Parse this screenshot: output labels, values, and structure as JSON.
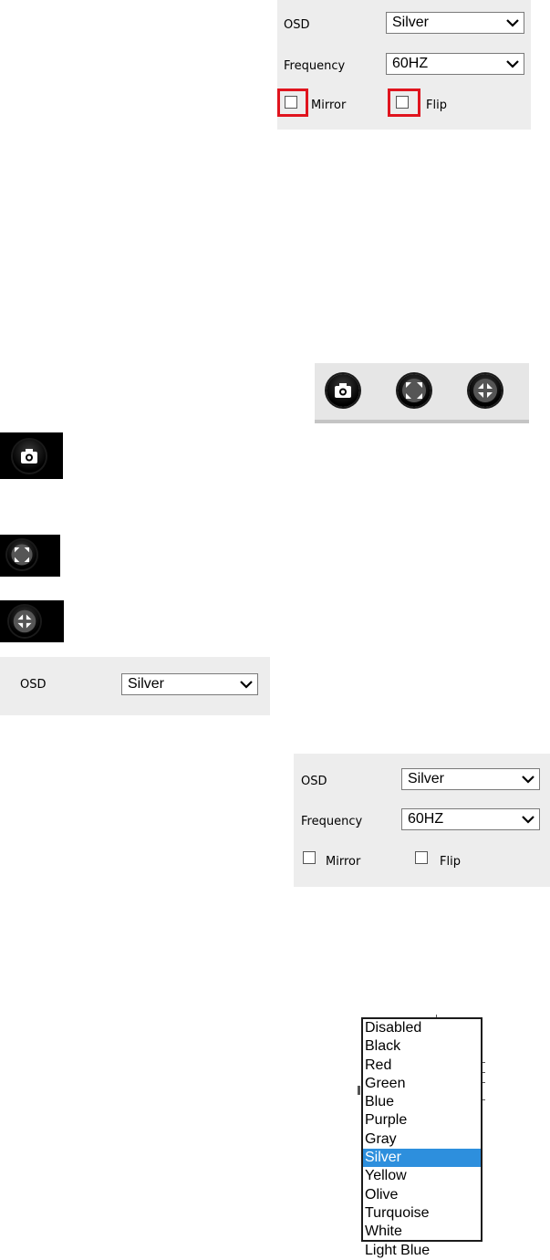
{
  "top_panel": {
    "osd_label": "OSD",
    "osd_value": "Silver",
    "frequency_label": "Frequency",
    "frequency_value": "60HZ",
    "mirror_label": "Mirror",
    "flip_label": "Flip",
    "highlight_color": "#e0141e"
  },
  "toolbar": {
    "icons": [
      "camera-snapshot-icon",
      "fullscreen-expand-icon",
      "fullscreen-collapse-icon"
    ]
  },
  "standalone_icons": [
    "camera-snapshot-icon",
    "fullscreen-expand-icon",
    "fullscreen-collapse-icon"
  ],
  "osd_row": {
    "label": "OSD",
    "value": "Silver"
  },
  "second_panel": {
    "osd_label": "OSD",
    "osd_value": "Silver",
    "frequency_label": "Frequency",
    "frequency_value": "60HZ",
    "mirror_label": "Mirror",
    "flip_label": "Flip"
  },
  "osd_dropdown": {
    "options": [
      "Disabled",
      "Black",
      "Red",
      "Green",
      "Blue",
      "Purple",
      "Gray",
      "Silver",
      "Yellow",
      "Olive",
      "Turquoise",
      "White",
      "Light Blue"
    ],
    "selected": "Silver",
    "selected_color": "#2d8fdd"
  }
}
